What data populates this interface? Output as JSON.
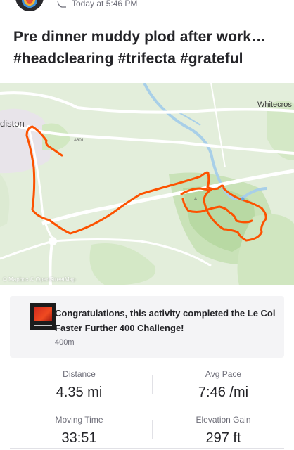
{
  "activity": {
    "timestamp": "Today at 5:46 PM",
    "title": "Pre dinner muddy plod after work… #headclearing #trifecta #grateful"
  },
  "map": {
    "labels": {
      "town_left": "diston",
      "town_right": "Whitecros",
      "road_a801": "A801",
      "road_a": "A..."
    },
    "attribution": "© Mapbox © OpenStreetMap",
    "route_color": "#fc5200"
  },
  "challenge": {
    "text": "Congratulations, this activity completed the Le Col Faster Further 400 Challenge!",
    "subtext": "400m"
  },
  "stats": {
    "distance_label": "Distance",
    "distance_value": "4.35 mi",
    "pace_label": "Avg Pace",
    "pace_value": "7:46 /mi",
    "moving_time_label": "Moving Time",
    "moving_time_value": "33:51",
    "elevation_label": "Elevation Gain",
    "elevation_value": "297 ft"
  }
}
